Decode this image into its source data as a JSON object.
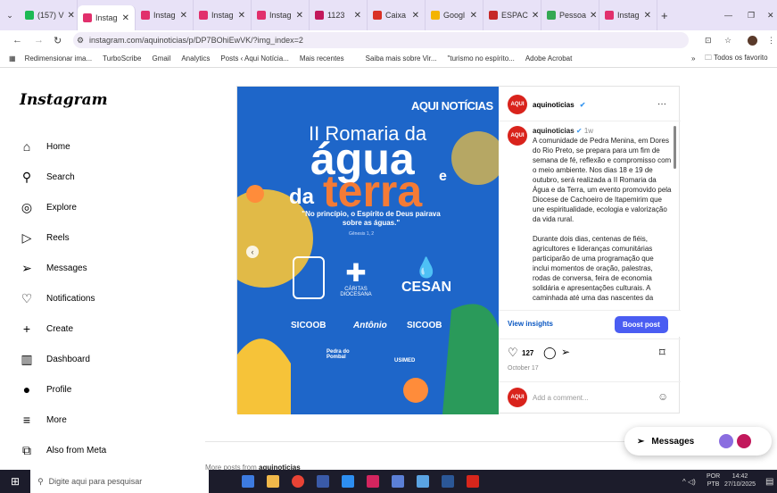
{
  "browser": {
    "tabs": [
      {
        "label": "(157) V",
        "color": "#1db954"
      },
      {
        "label": "Instag",
        "color": "#e1306c",
        "active": true
      },
      {
        "label": "Instag",
        "color": "#e1306c"
      },
      {
        "label": "Instag",
        "color": "#e1306c"
      },
      {
        "label": "Instag",
        "color": "#e1306c"
      },
      {
        "label": "1123",
        "color": "#c2185b"
      },
      {
        "label": "Caixa",
        "color": "#d93025"
      },
      {
        "label": "Googl",
        "color": "#f4b400"
      },
      {
        "label": "ESPAC",
        "color": "#c62828"
      },
      {
        "label": "Pessoa",
        "color": "#34a853"
      },
      {
        "label": "Instag",
        "color": "#e1306c"
      }
    ],
    "url": "instagram.com/aquinoticias/p/DP7BOhiEwVK/?img_index=2",
    "bookmarks": [
      "Redimensionar ima...",
      "TurboScribe",
      "Gmail",
      "Analytics",
      "Posts ‹ Aqui Notícia...",
      "Mais recentes",
      "",
      "Saiba mais sobre Vir...",
      "\"turismo no espírito...",
      "Adobe Acrobat"
    ],
    "all_bookmarks": "Todos os favorito"
  },
  "sidebar": {
    "logo": "Instagram",
    "items": [
      {
        "label": "Home",
        "icon": "⌂"
      },
      {
        "label": "Search",
        "icon": "⚲"
      },
      {
        "label": "Explore",
        "icon": "◎"
      },
      {
        "label": "Reels",
        "icon": "▷"
      },
      {
        "label": "Messages",
        "icon": "➢"
      },
      {
        "label": "Notifications",
        "icon": "♡"
      },
      {
        "label": "Create",
        "icon": "+"
      },
      {
        "label": "Dashboard",
        "icon": "▥"
      },
      {
        "label": "Profile",
        "icon": "●"
      },
      {
        "label": "More",
        "icon": "≡"
      },
      {
        "label": "Also from Meta",
        "icon": "⧉"
      }
    ]
  },
  "poster": {
    "brand": "AQUI NOTÍCIAS",
    "title1": "II Romaria da",
    "title2": "água",
    "title3a": "da",
    "title3b": "terra",
    "e": "e",
    "quote": "\"No princípio, o Espírito de Deus pairava sobre as águas.\"",
    "ref": "Gênesis 1, 2",
    "sponsors": [
      "CÁRITAS DIOCESANA",
      "CESAN",
      "SICOOB",
      "Antônio",
      "SICOOB",
      "Pedra do Pombal",
      "USIMED"
    ]
  },
  "post": {
    "username": "aquinoticias",
    "avatar_text": "AQUI",
    "time": "1w",
    "caption": "A comunidade de Pedra Menina, em Dores do Rio Preto, se prepara para um fim de semana de fé, reflexão e compromisso com o meio ambiente. Nos dias 18 e 19 de outubro, será realizada a II Romaria da Água e da Terra, um evento promovido pela Diocese de Cachoeiro de Itapemirim que une espiritualidade, ecologia e valorização da vida rural.",
    "caption2": "Durante dois dias, centenas de fiéis, agricultores e lideranças comunitárias participarão de uma programação que inclui momentos de oração, palestras, rodas de conversa, feira de economia solidária e apresentações culturais. A caminhada até uma das nascentes da",
    "view_insights": "View insights",
    "boost": "Boost post",
    "likes": "127",
    "date": "October 17",
    "comment_placeholder": "Add a comment...",
    "more_posts": "More posts from",
    "more_posts_user": "aquinoticias",
    "messages": "Messages"
  },
  "taskbar": {
    "search": "Digite aqui para pesquisar",
    "lang1": "POR",
    "lang2": "PTB",
    "time": "14:42",
    "date": "27/10/2025"
  }
}
